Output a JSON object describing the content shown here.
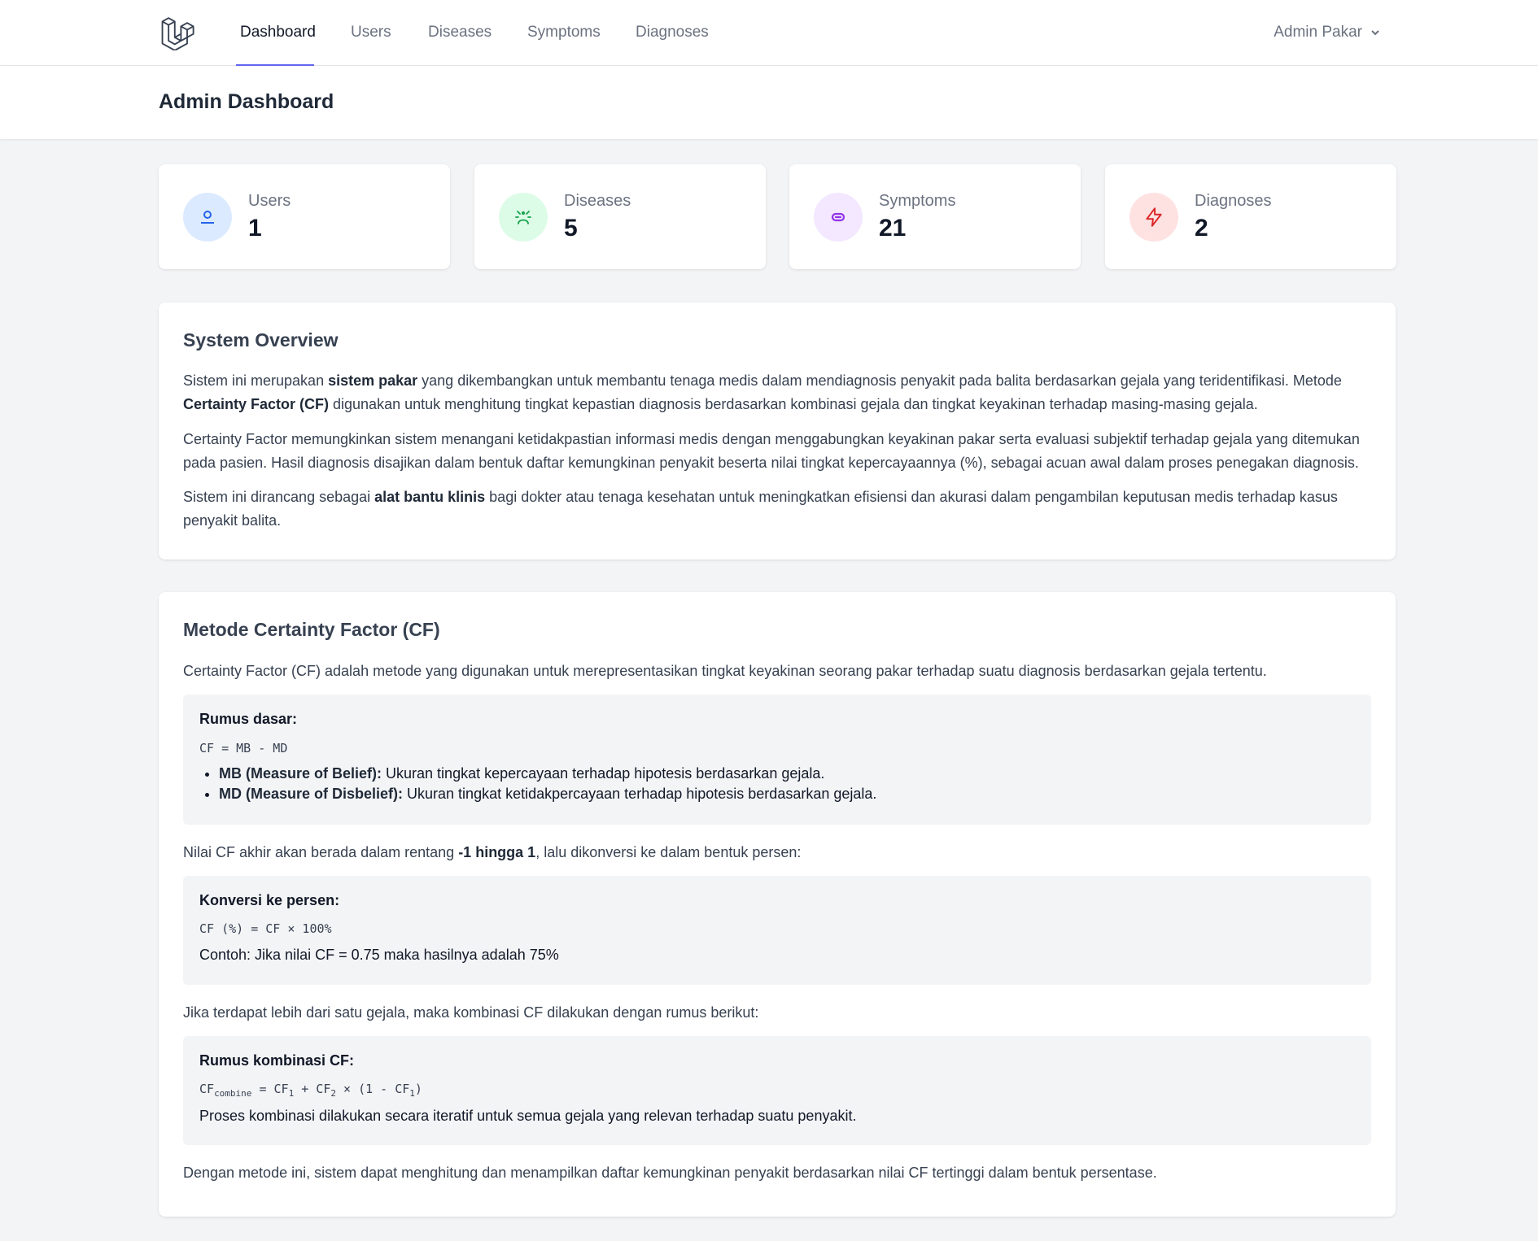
{
  "nav": {
    "links": [
      "Dashboard",
      "Users",
      "Diseases",
      "Symptoms",
      "Diagnoses"
    ],
    "active": "Dashboard",
    "user_name": "Admin Pakar"
  },
  "header": {
    "title": "Admin Dashboard"
  },
  "stats": [
    {
      "label": "Users",
      "value": "1",
      "icon": "user-icon",
      "bg": "#dbeafe",
      "fg": "#2563eb"
    },
    {
      "label": "Diseases",
      "value": "5",
      "icon": "virus-icon",
      "bg": "#dcfce7",
      "fg": "#16a34a"
    },
    {
      "label": "Symptoms",
      "value": "21",
      "icon": "pill-icon",
      "bg": "#f3e8ff",
      "fg": "#9333ea"
    },
    {
      "label": "Diagnoses",
      "value": "2",
      "icon": "bolt-icon",
      "bg": "#fee2e2",
      "fg": "#dc2626"
    }
  ],
  "overview": {
    "title": "System Overview",
    "p1_a": "Sistem ini merupakan ",
    "p1_b": "sistem pakar",
    "p1_c": " yang dikembangkan untuk membantu tenaga medis dalam mendiagnosis penyakit pada balita berdasarkan gejala yang teridentifikasi. Metode ",
    "p1_d": "Certainty Factor (CF)",
    "p1_e": " digunakan untuk menghitung tingkat kepastian diagnosis berdasarkan kombinasi gejala dan tingkat keyakinan terhadap masing-masing gejala.",
    "p2": "Certainty Factor memungkinkan sistem menangani ketidakpastian informasi medis dengan menggabungkan keyakinan pakar serta evaluasi subjektif terhadap gejala yang ditemukan pada pasien. Hasil diagnosis disajikan dalam bentuk daftar kemungkinan penyakit beserta nilai tingkat kepercayaannya (%), sebagai acuan awal dalam proses penegakan diagnosis.",
    "p3_a": "Sistem ini dirancang sebagai ",
    "p3_b": "alat bantu klinis",
    "p3_c": " bagi dokter atau tenaga kesehatan untuk meningkatkan efisiensi dan akurasi dalam pengambilan keputusan medis terhadap kasus penyakit balita."
  },
  "cf": {
    "title": "Metode Certainty Factor (CF)",
    "intro": "Certainty Factor (CF) adalah metode yang digunakan untuk merepresentasikan tingkat keyakinan seorang pakar terhadap suatu diagnosis berdasarkan gejala tertentu.",
    "basic_title": "Rumus dasar:",
    "basic_formula": "CF = MB - MD",
    "mb_label": "MB (Measure of Belief):",
    "mb_text": " Ukuran tingkat kepercayaan terhadap hipotesis berdasarkan gejala.",
    "md_label": "MD (Measure of Disbelief):",
    "md_text": " Ukuran tingkat ketidakpercayaan terhadap hipotesis berdasarkan gejala.",
    "range_a": "Nilai CF akhir akan berada dalam rentang ",
    "range_b": "-1 hingga 1",
    "range_c": ", lalu dikonversi ke dalam bentuk persen:",
    "conv_title": "Konversi ke persen:",
    "conv_formula": "CF (%) = CF × 100%",
    "conv_example": "Contoh: Jika nilai CF = 0.75 maka hasilnya adalah 75%",
    "combo_intro": "Jika terdapat lebih dari satu gejala, maka kombinasi CF dilakukan dengan rumus berikut:",
    "combo_title": "Rumus kombinasi CF:",
    "combo_cf": "CF",
    "combo_sub": "combine",
    "combo_eq": " = CF",
    "sub1": "1",
    "combo_plus": " + CF",
    "sub2": "2",
    "combo_times": " × (1 - CF",
    "sub3": "1",
    "combo_close": ")",
    "combo_note": "Proses kombinasi dilakukan secara iteratif untuk semua gejala yang relevan terhadap suatu penyakit.",
    "closing": "Dengan metode ini, sistem dapat menghitung dan menampilkan daftar kemungkinan penyakit berdasarkan nilai CF tertinggi dalam bentuk persentase."
  }
}
